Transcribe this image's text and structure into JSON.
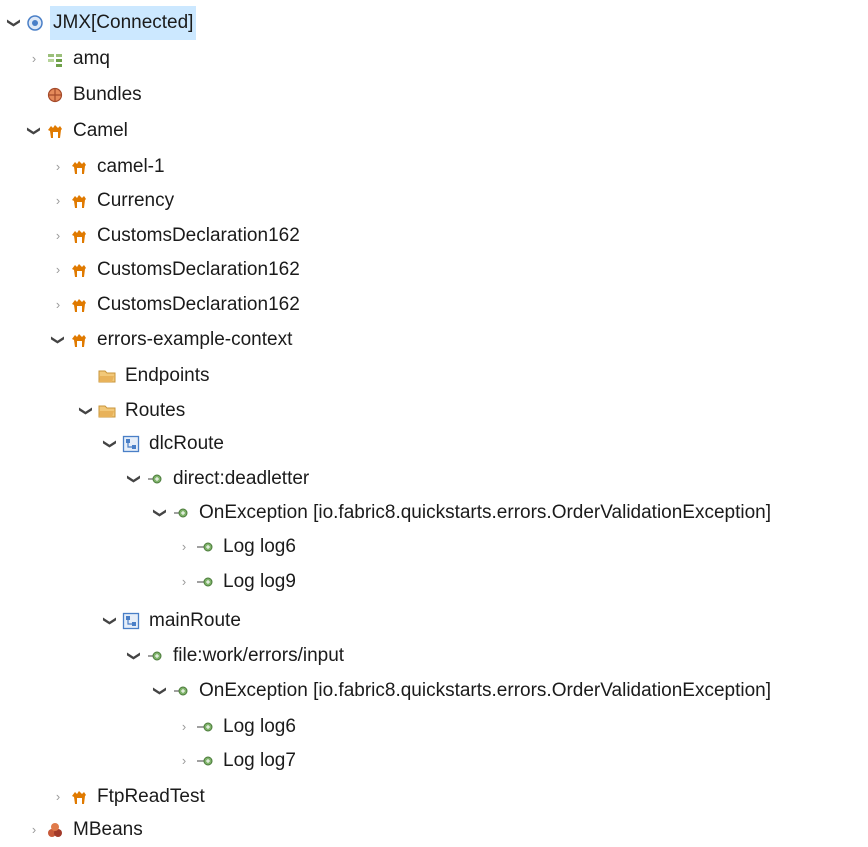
{
  "colors": {
    "selection": "#cce8ff",
    "camel": "#e07a00",
    "folder": "#e8b25a",
    "route_blue": "#4a7fc7",
    "step_green": "#5a9a4a",
    "mbeans": "#b04a3a"
  },
  "tree": {
    "jmx": {
      "label": "JMX[Connected]",
      "icon": "server-connected-icon",
      "state": "expanded"
    },
    "amq": {
      "label": "amq",
      "icon": "broker-icon",
      "state": "collapsed"
    },
    "bundles": {
      "label": "Bundles",
      "icon": "bundles-icon",
      "state": "leaf"
    },
    "camel": {
      "label": "Camel",
      "icon": "camel-icon",
      "state": "expanded"
    },
    "camel_1": {
      "label": "camel-1",
      "icon": "camel-icon",
      "state": "collapsed"
    },
    "currency": {
      "label": "Currency",
      "icon": "camel-icon",
      "state": "collapsed"
    },
    "customs_1": {
      "label": "CustomsDeclaration162",
      "icon": "camel-icon",
      "state": "collapsed"
    },
    "customs_2": {
      "label": "CustomsDeclaration162",
      "icon": "camel-icon",
      "state": "collapsed"
    },
    "customs_3": {
      "label": "CustomsDeclaration162",
      "icon": "camel-icon",
      "state": "collapsed"
    },
    "errors_ctx": {
      "label": "errors-example-context",
      "icon": "camel-icon",
      "state": "expanded"
    },
    "endpoints": {
      "label": "Endpoints",
      "icon": "folder-icon",
      "state": "leaf"
    },
    "routes": {
      "label": "Routes",
      "icon": "folder-icon",
      "state": "expanded"
    },
    "dlc_route": {
      "label": "dlcRoute",
      "icon": "route-icon",
      "state": "expanded"
    },
    "direct_deadletter": {
      "label": "direct:deadletter",
      "icon": "endpoint-icon",
      "state": "expanded"
    },
    "on_exception_1": {
      "label": "OnException [io.fabric8.quickstarts.errors.OrderValidationException]",
      "icon": "endpoint-icon",
      "state": "expanded"
    },
    "log6_a": {
      "label": "Log log6",
      "icon": "log-icon",
      "state": "collapsed"
    },
    "log9": {
      "label": "Log log9",
      "icon": "log-icon",
      "state": "collapsed"
    },
    "main_route": {
      "label": "mainRoute",
      "icon": "route-icon",
      "state": "expanded"
    },
    "file_input": {
      "label": "file:work/errors/input",
      "icon": "endpoint-icon",
      "state": "expanded"
    },
    "on_exception_2": {
      "label": "OnException [io.fabric8.quickstarts.errors.OrderValidationException]",
      "icon": "endpoint-icon",
      "state": "expanded"
    },
    "log6_b": {
      "label": "Log log6",
      "icon": "log-icon",
      "state": "collapsed"
    },
    "log7": {
      "label": "Log log7",
      "icon": "log-icon",
      "state": "collapsed"
    },
    "ftp_read_test": {
      "label": "FtpReadTest",
      "icon": "camel-icon",
      "state": "collapsed"
    },
    "mbeans": {
      "label": "MBeans",
      "icon": "mbeans-icon",
      "state": "collapsed"
    }
  }
}
